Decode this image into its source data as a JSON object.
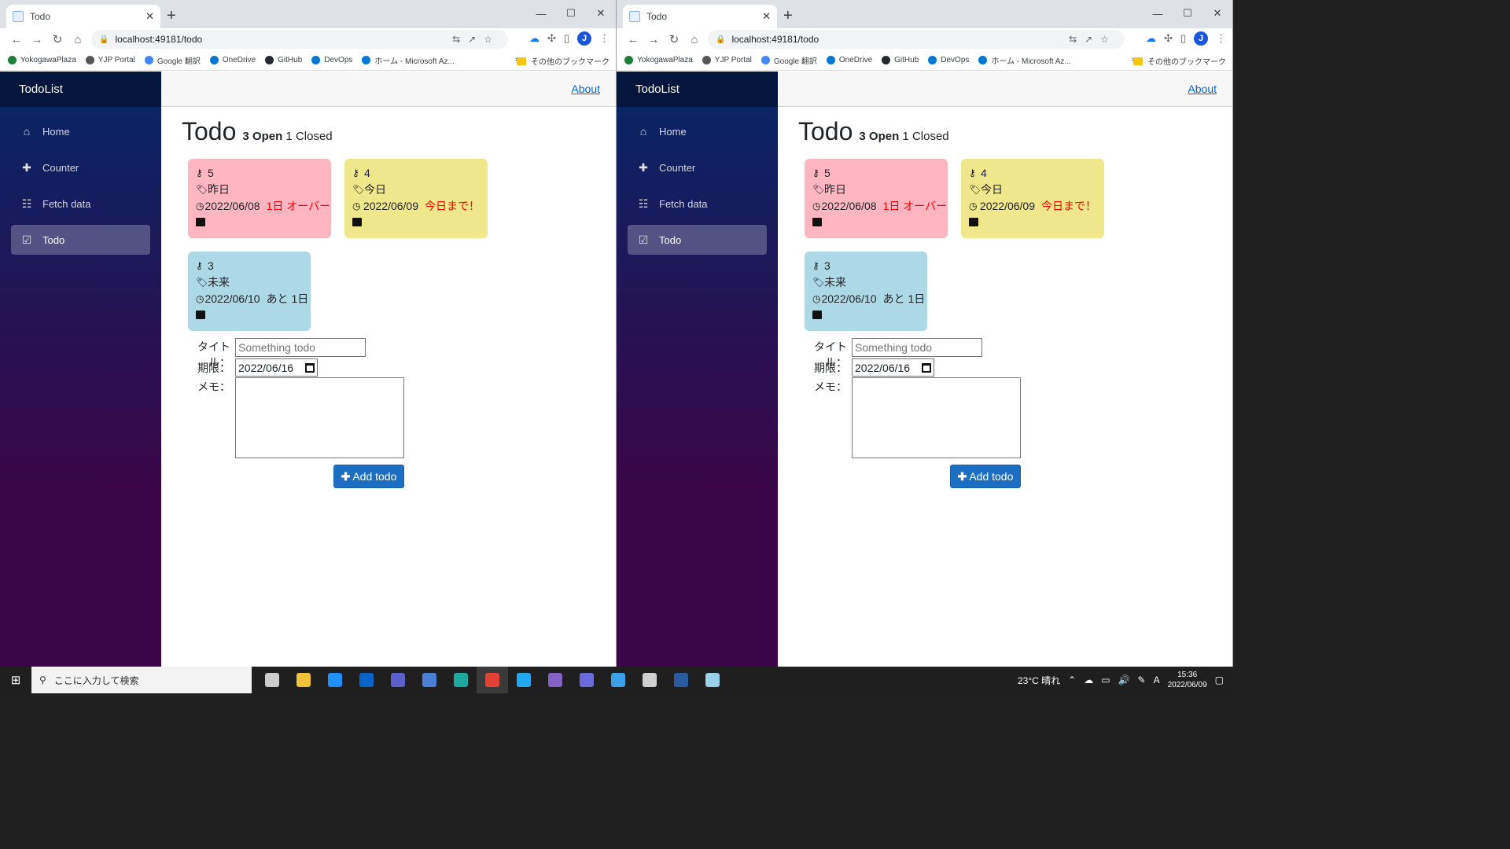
{
  "browser": {
    "tab_title": "Todo",
    "tab_close": "✕",
    "new_tab": "+",
    "address": "localhost:49181/todo",
    "window_controls": [
      "—",
      "☐",
      "✕"
    ],
    "bookmarks": [
      {
        "label": "YokogawaPlaza",
        "color": "#1a7f37"
      },
      {
        "label": "YJP Portal",
        "color": "#555555"
      },
      {
        "label": "Google 翻訳",
        "color": "#4285f4"
      },
      {
        "label": "OneDrive",
        "color": "#0078d4"
      },
      {
        "label": "GitHub",
        "color": "#24292f"
      },
      {
        "label": "DevOps",
        "color": "#0078d4"
      },
      {
        "label": "ホーム - Microsoft Az...",
        "color": "#0078d4"
      }
    ],
    "bookmarks_more": "»",
    "other_bookmarks": "その他のブックマーク",
    "profile_initial": "J"
  },
  "app": {
    "brand": "TodoList",
    "about": "About",
    "nav": [
      {
        "label": "Home",
        "icon": "⌂",
        "icon_name": "home-icon",
        "active": false
      },
      {
        "label": "Counter",
        "icon": "✚",
        "icon_name": "plus-icon",
        "active": false
      },
      {
        "label": "Fetch data",
        "icon": "☷",
        "icon_name": "list-icon",
        "active": false
      },
      {
        "label": "Todo",
        "icon": "☑",
        "icon_name": "checkbox-icon",
        "active": true
      }
    ],
    "page_title": "Todo",
    "open_count": "3",
    "open_label": "Open",
    "closed_count": "1",
    "closed_label": "Closed",
    "todos": [
      {
        "id": "5",
        "title": "昨日",
        "due": "2022/06/08",
        "status": "1日 オーバー",
        "color": "#ffb6c1"
      },
      {
        "id": "4",
        "title": "今日",
        "due": "2022/06/09",
        "status": "今日まで！",
        "color": "#f0e68c"
      },
      {
        "id": "3",
        "title": "未来",
        "due": "2022/06/10",
        "status": "あと 1日",
        "color": "#add8e6"
      }
    ],
    "form": {
      "title_label": "タイトル：",
      "title_placeholder": "Something todo",
      "due_label": "期限：",
      "due_value": "2022/06/16",
      "memo_label": "メモ：",
      "add_button": "Add todo"
    }
  },
  "taskbar": {
    "search_placeholder": "ここに入力して検索",
    "weather": "23°C 晴れ",
    "ime": "A",
    "time": "15:36",
    "date": "2022/06/09"
  }
}
